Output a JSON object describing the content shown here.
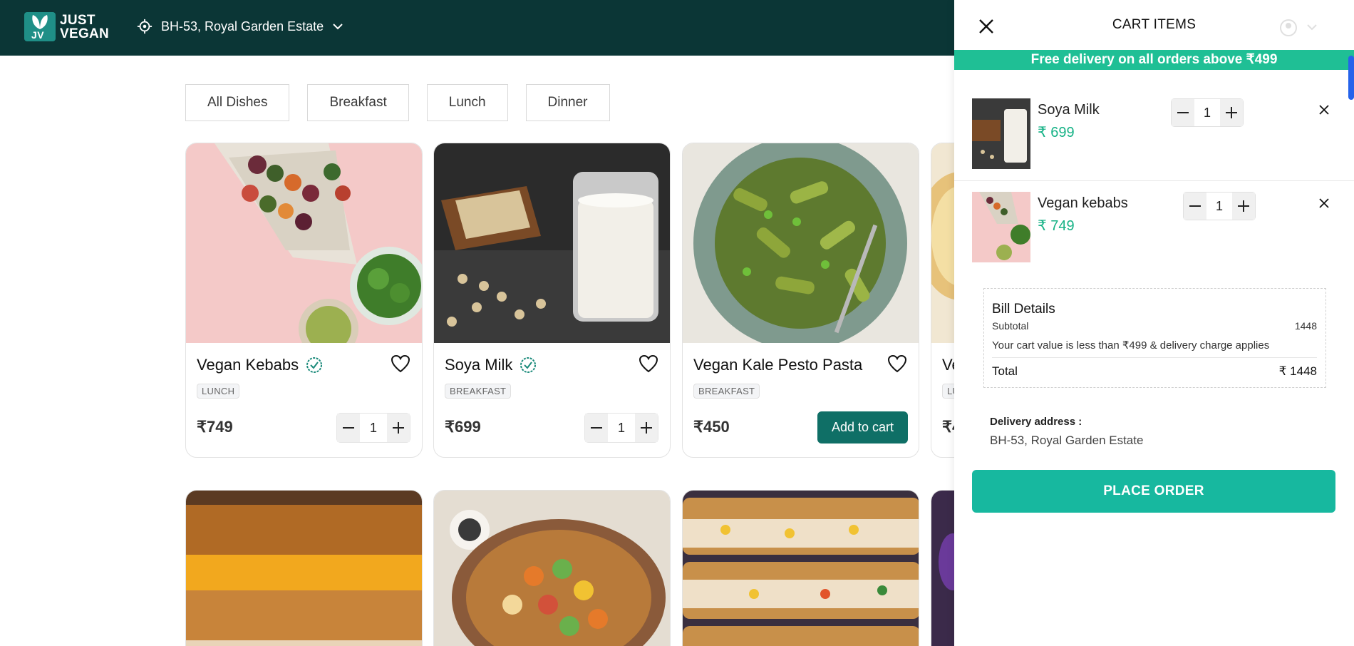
{
  "brand": {
    "logo_mark": "JV",
    "name_line1": "JUST",
    "name_line2": "VEGAN"
  },
  "header": {
    "location": "BH-53, Royal Garden Estate",
    "location_icon": "location-pin-icon",
    "dropdown_icon": "chevron-down-icon"
  },
  "filters": [
    "All Dishes",
    "Breakfast",
    "Lunch",
    "Dinner"
  ],
  "products": [
    {
      "name": "Vegan Kebabs",
      "verified": true,
      "category": "LUNCH",
      "price": "₹749",
      "quantity": "1"
    },
    {
      "name": "Soya Milk",
      "verified": true,
      "category": "BREAKFAST",
      "price": "₹699",
      "quantity": "1"
    },
    {
      "name": "Vegan Kale Pesto Pasta",
      "verified": false,
      "category": "BREAKFAST",
      "price": "₹450",
      "add_label": "Add to cart"
    },
    {
      "name": "Ve",
      "category": "LU",
      "price": "₹4"
    }
  ],
  "cart": {
    "title": "CART ITEMS",
    "promo": "Free delivery on all orders above ₹499",
    "items": [
      {
        "name": "Soya Milk",
        "price": "₹ 699",
        "quantity": "1"
      },
      {
        "name": "Vegan kebabs",
        "price": "₹ 749",
        "quantity": "1"
      }
    ],
    "bill": {
      "title": "Bill Details",
      "subtotal_label": "Subtotal",
      "subtotal_value": "1448",
      "note": "Your cart value is less than ₹499 & delivery charge applies",
      "total_label": "Total",
      "total_value": "₹ 1448"
    },
    "delivery_label": "Delivery address :",
    "delivery_address": "BH-53, Royal Garden Estate",
    "place_order": "PLACE ORDER"
  },
  "colors": {
    "header_bg": "#0b3636",
    "accent": "#17b89f",
    "promo": "#1fbf95",
    "add_btn": "#0f6f66",
    "price_green": "#16b286"
  }
}
